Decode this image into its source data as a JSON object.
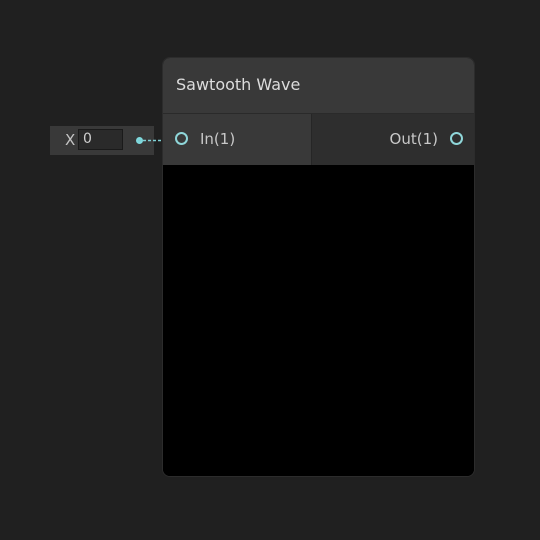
{
  "node": {
    "title": "Sawtooth Wave",
    "input_port_label": "In(1)",
    "output_port_label": "Out(1)"
  },
  "inline_field": {
    "axis_label": "X",
    "value": "0"
  },
  "colors": {
    "canvas_background": "#202020",
    "node_header": "#393939",
    "port_accent": "#8fd6d9",
    "preview_background": "#000000"
  },
  "icons": {
    "input_port": "port-circle-icon",
    "output_port": "port-circle-icon",
    "field_port": "port-dot-icon"
  }
}
